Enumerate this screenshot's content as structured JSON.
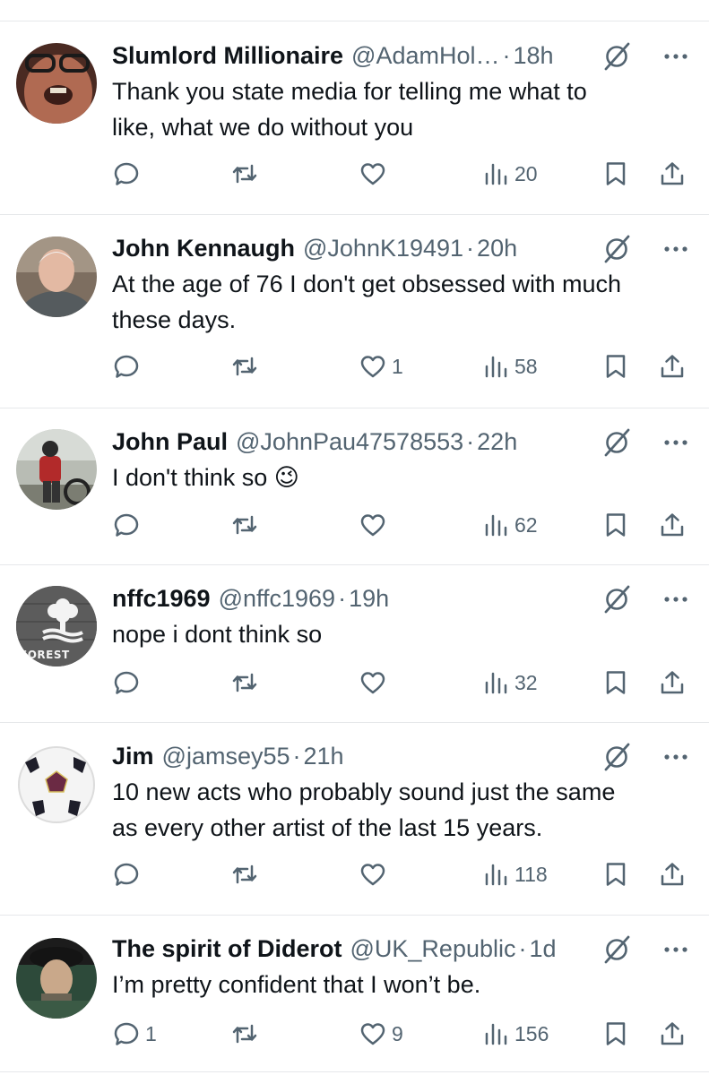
{
  "tweets": [
    {
      "name": "Slumlord Millionaire",
      "handle": "@AdamHol…",
      "time": "18h",
      "text": "Thank you state media for telling me what to\nlike, what we do without you",
      "replies": "",
      "reposts": "",
      "likes": "",
      "views": "20"
    },
    {
      "name": "John Kennaugh",
      "handle": "@JohnK19491",
      "time": "20h",
      "text": "At the age of 76 I don't get obsessed with much\nthese days.",
      "replies": "",
      "reposts": "",
      "likes": "1",
      "views": "58"
    },
    {
      "name": "John Paul",
      "handle": "@JohnPau47578553",
      "time": "22h",
      "text": "I don't think so 😉",
      "replies": "",
      "reposts": "",
      "likes": "",
      "views": "62"
    },
    {
      "name": "nffc1969",
      "handle": "@nffc1969",
      "time": "19h",
      "text": "nope i dont think so",
      "replies": "",
      "reposts": "",
      "likes": "",
      "views": "32",
      "avatar_text": "FOREST"
    },
    {
      "name": "Jim",
      "handle": "@jamsey55",
      "time": "21h",
      "text": "10 new acts who probably sound just the same\nas every other artist of the last 15 years.",
      "replies": "",
      "reposts": "",
      "likes": "",
      "views": "118"
    },
    {
      "name": "The spirit of Diderot",
      "handle": "@UK_Republic",
      "time": "1d",
      "text": "I’m pretty confident that I won’t be.",
      "replies": "1",
      "reposts": "",
      "likes": "9",
      "views": "156"
    }
  ],
  "meta_separator": "·",
  "icons": {
    "reply": "reply-icon",
    "repost": "repost-icon",
    "like": "like-icon",
    "views": "views-icon",
    "bookmark": "bookmark-icon",
    "share": "share-icon",
    "grok": "grok-icon",
    "more": "more-icon"
  },
  "colors": {
    "text": "#0f1419",
    "secondary": "#536471",
    "separator": "#e6e8ea"
  }
}
